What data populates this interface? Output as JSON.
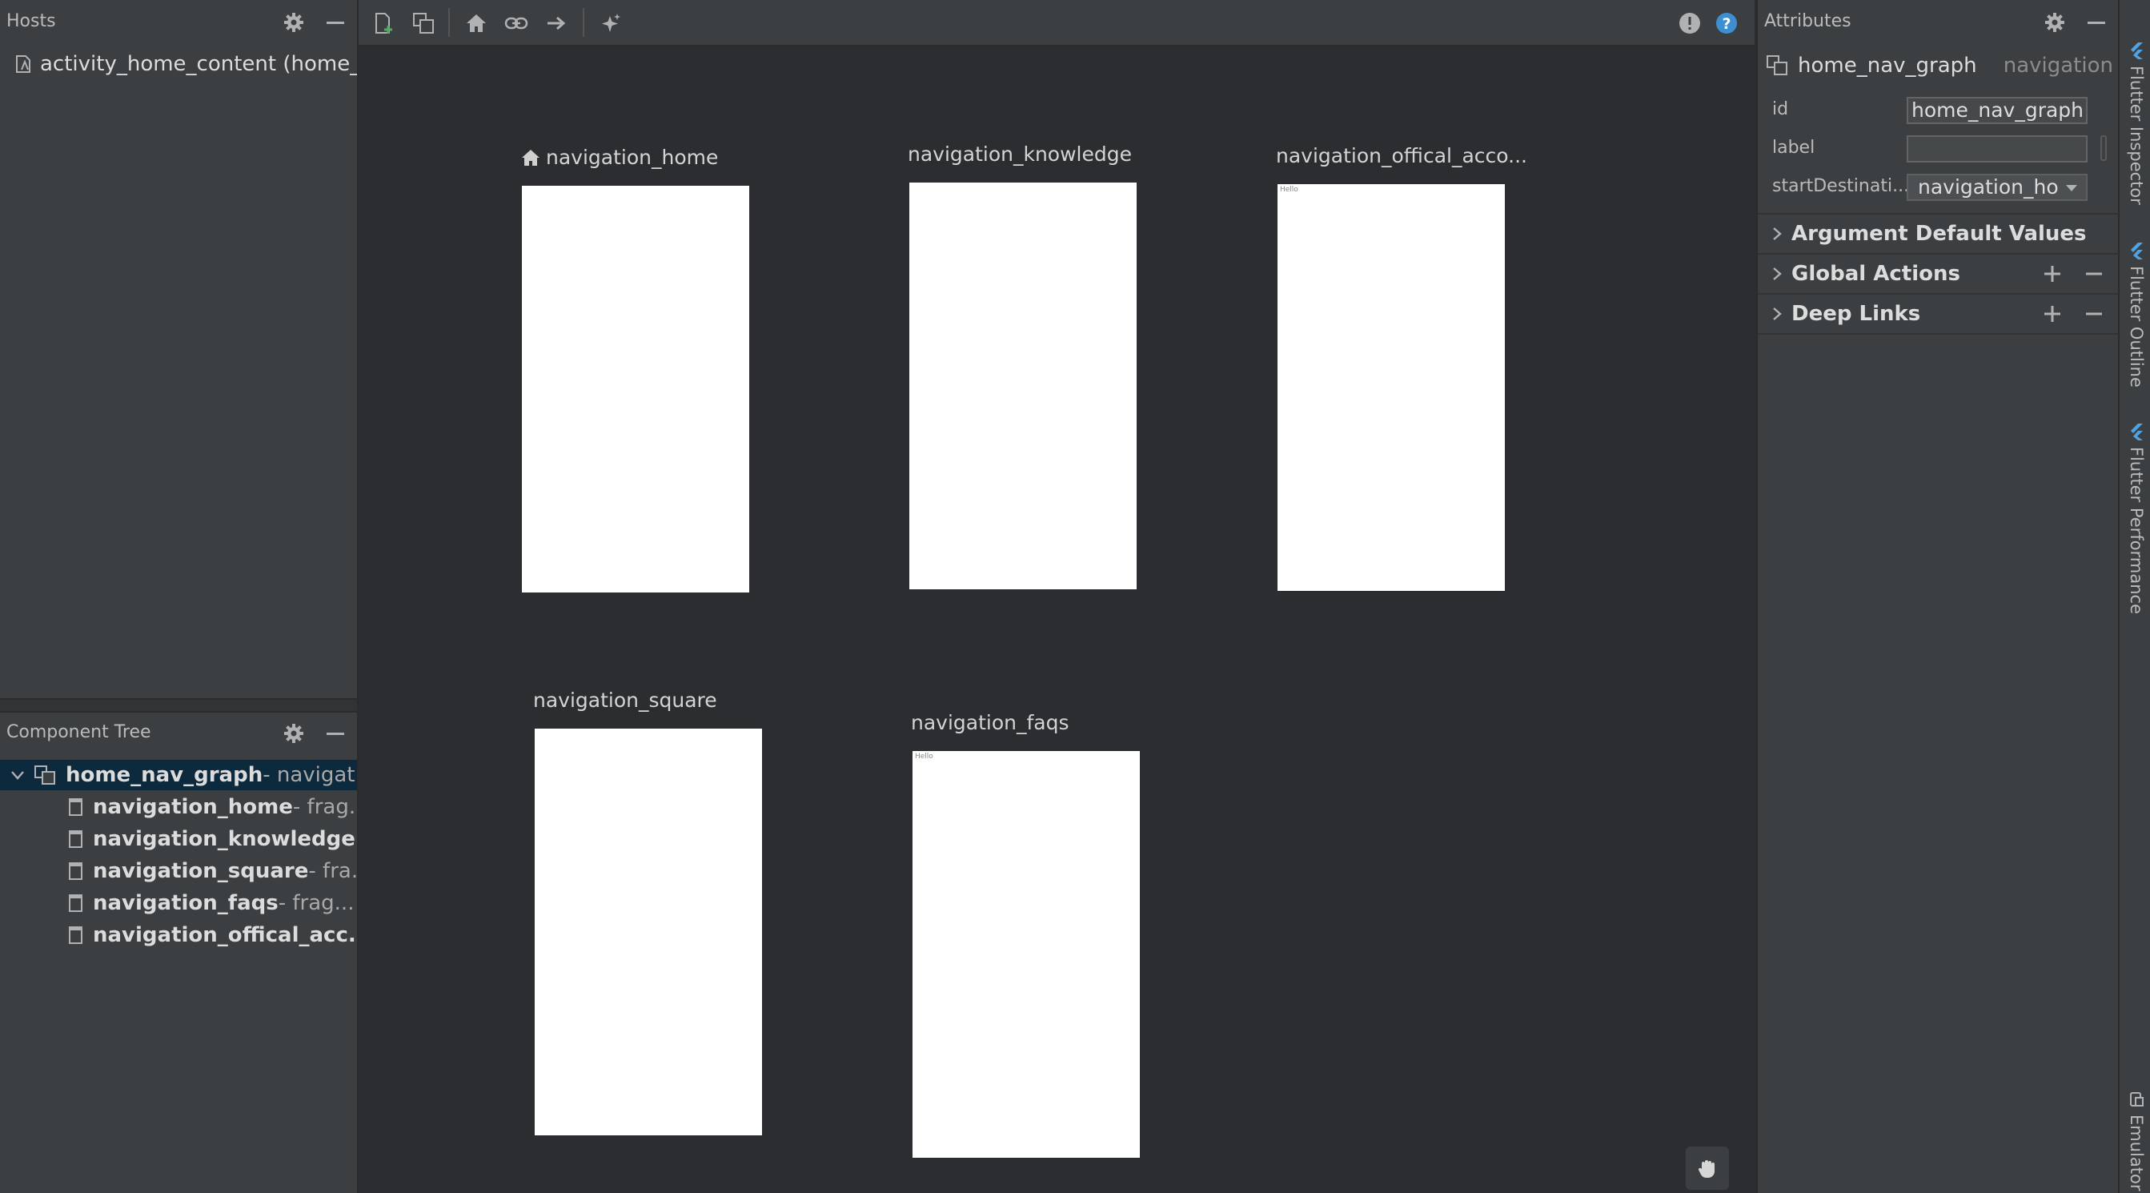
{
  "hosts_panel": {
    "title": "Hosts",
    "items": [
      {
        "label": "activity_home_content (home_fra"
      }
    ]
  },
  "component_tree": {
    "title": "Component Tree",
    "root": {
      "name": "home_nav_graph",
      "type": " - navigat..."
    },
    "children": [
      {
        "name": "navigation_home",
        "type": " - frag..."
      },
      {
        "name": "navigation_knowledge",
        "type": " ..."
      },
      {
        "name": "navigation_square",
        "type": " - fra..."
      },
      {
        "name": "navigation_faqs",
        "type": " - frag..."
      },
      {
        "name": "navigation_offical_acc...",
        "type": ""
      }
    ]
  },
  "toolbar": {
    "icons": [
      "new-destination-icon",
      "nested-graph-icon",
      "home-icon",
      "deep-link-icon",
      "action-arrow-icon",
      "auto-arrange-icon",
      "warning-icon",
      "help-icon"
    ]
  },
  "canvas": {
    "destinations": [
      {
        "label": "navigation_home",
        "is_start": true,
        "preview_text": ""
      },
      {
        "label": "navigation_knowledge",
        "is_start": false,
        "preview_text": ""
      },
      {
        "label": "navigation_offical_acco...",
        "is_start": false,
        "preview_text": "Hello"
      },
      {
        "label": "navigation_square",
        "is_start": false,
        "preview_text": ""
      },
      {
        "label": "navigation_faqs",
        "is_start": false,
        "preview_text": "Hello"
      }
    ]
  },
  "attributes": {
    "title": "Attributes",
    "selected": {
      "name": "home_nav_graph",
      "type": "navigation"
    },
    "fields": {
      "id": {
        "label": "id",
        "value": "home_nav_graph"
      },
      "label": {
        "label": "label",
        "value": ""
      },
      "start": {
        "label": "startDestinati...",
        "value": "navigation_ho"
      }
    },
    "sections": {
      "arg_defaults": "Argument Default Values",
      "global_actions": "Global Actions",
      "deep_links": "Deep Links"
    }
  },
  "side_strip": {
    "tabs": [
      "Flutter Inspector",
      "Flutter Outline",
      "Flutter Performance",
      "Emulator"
    ]
  },
  "colors": {
    "panel_bg": "#3c3f41",
    "canvas_bg": "#2b2d30",
    "selection_bg": "#0d293e",
    "flutter_blue": "#4fa3e3",
    "help_blue": "#3d8fd1"
  }
}
